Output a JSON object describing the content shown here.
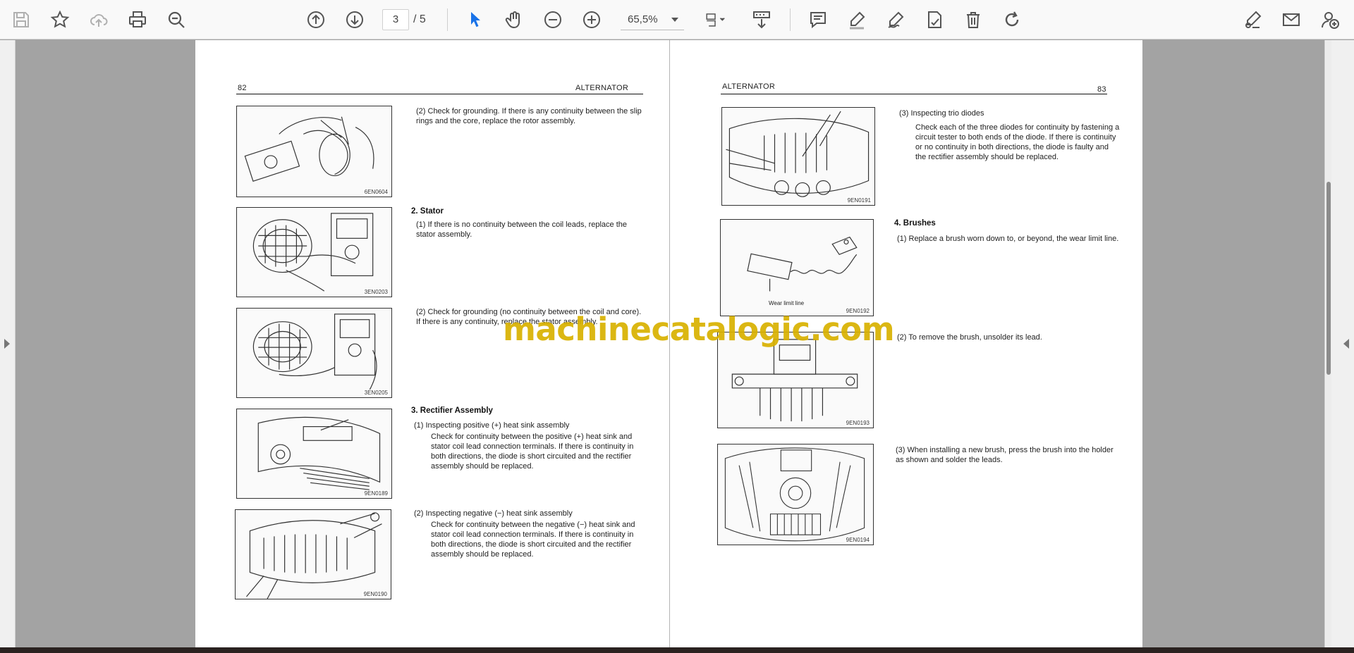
{
  "toolbar": {
    "page_current": "3",
    "page_total": "/ 5",
    "zoom": "65,5%"
  },
  "colors": {
    "accent": "#1a73e8",
    "watermark": "#d9b100"
  },
  "left_page": {
    "page_number": "82",
    "header": "ALTERNATOR",
    "figures": [
      "6EN0604",
      "3EN0203",
      "3EN0205",
      "9EN0189",
      "9EN0190"
    ],
    "p2_grounding": "(2)   Check for grounding.  If there is any continuity between the slip rings and the core, replace the rotor assembly.",
    "stator_title": "2.  Stator",
    "stator_1": "(1)   If there is no continuity between the coil leads, replace the stator assembly.",
    "stator_2": "(2)   Check for grounding (no continuity between the coil and core).  If there is any continuity, replace the stator assembly.",
    "rect_title": "3.  Rectifier Assembly",
    "rect_1_head": "(1)   Inspecting positive (+) heat sink assembly",
    "rect_1_body": "Check for continuity between the positive (+) heat sink and stator coil lead connection terminals.  If there is continuity in both directions, the diode is short circuited and the rectifier assembly should be replaced.",
    "rect_2_head": "(2)   Inspecting negative (−) heat sink assembly",
    "rect_2_body": "Check for continuity between the negative (−) heat sink and stator coil lead connection terminals.  If there is continuity in both directions, the diode is short circuited and the rectifier assembly should be replaced."
  },
  "right_page": {
    "page_number": "83",
    "header": "ALTERNATOR",
    "figures": [
      "9EN0191",
      "9EN0192",
      "9EN0193",
      "9EN0194"
    ],
    "wear_label": "Wear limit line",
    "trio_head": "(3)   Inspecting trio diodes",
    "trio_body": "Check each of the three diodes for continuity by fastening a circuit tester to both ends of the diode.  If there is continuity or no continuity in both directions, the diode is faulty and the rectifier assembly should be replaced.",
    "brush_title": "4.  Brushes",
    "brush_1": "(1)   Replace a brush worn down to, or beyond, the wear limit line.",
    "brush_2": "(2)   To remove the brush, unsolder its lead.",
    "brush_3": "(3)   When installing a new brush, press the brush into the holder as shown and solder the leads."
  },
  "watermark": "machinecatalogic.com"
}
